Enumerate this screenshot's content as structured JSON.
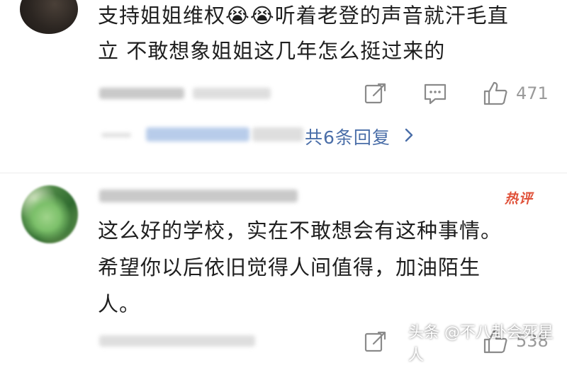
{
  "comments": [
    {
      "text_line1": "支持姐姐维权😭😭听着老登的声音就汗毛直",
      "text_line2": "立 不敢想象姐姐这几年怎么挺过来的",
      "like_count": "471",
      "replies_label": "共6条回复"
    },
    {
      "hot_badge": "热评",
      "text_line1": "这么好的学校，实在不敢想会有这种事情。",
      "text_line2": "希望你以后依旧觉得人间值得，加油陌生",
      "text_line3": "人。",
      "like_count": "538"
    }
  ],
  "watermark": "头条 @不八卦会死星人",
  "icons": {
    "share": "share-icon",
    "comment": "comment-icon",
    "like": "thumbs-up-icon",
    "chevron": "chevron-right-icon"
  },
  "colors": {
    "link": "#4a6ea8",
    "hot": "#e0523a",
    "muted": "#9a9a9a"
  }
}
